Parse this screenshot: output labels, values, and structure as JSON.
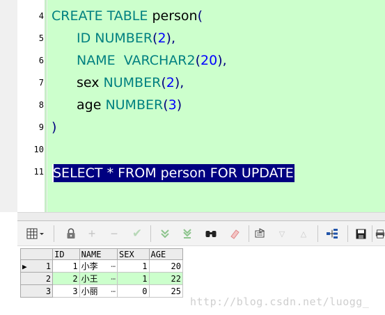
{
  "editor": {
    "line_numbers": [
      "4",
      "5",
      "6",
      "7",
      "8",
      "9",
      "10",
      "11"
    ],
    "code": {
      "l4_kw": "CREATE TABLE ",
      "l4_id": "person",
      "l4_p": "(",
      "l5_kw": "ID NUMBER",
      "l5_p1": "(",
      "l5_n": "2",
      "l5_p2": "),",
      "l6_kw": "NAME  VARCHAR2",
      "l6_p1": "(",
      "l6_n": "20",
      "l6_p2": "),",
      "l7_id": "sex ",
      "l7_kw": "NUMBER",
      "l7_p1": "(",
      "l7_n": "2",
      "l7_p2": "),",
      "l8_id": "age ",
      "l8_kw": "NUMBER",
      "l8_p1": "(",
      "l8_n": "3",
      "l8_p2": ")",
      "l9_p": ")",
      "l11": "SELECT * FROM person FOR UPDATE"
    },
    "colors": {
      "code_bg": "#ccffcc",
      "keyword": "#008080",
      "number": "#0000ff",
      "selection": "#000080"
    }
  },
  "toolbar": {
    "icons": [
      "grid-menu-icon",
      "lock-icon",
      "add-record-icon",
      "delete-record-icon",
      "post-changes-icon",
      "fetch-next-icon",
      "fetch-last-icon",
      "find-icon",
      "clear-icon",
      "query-by-example-icon",
      "next-icon",
      "previous-icon",
      "single-record-icon",
      "save-icon",
      "print-icon"
    ]
  },
  "grid": {
    "columns": [
      "",
      "ID",
      "NAME",
      "SEX",
      "AGE"
    ],
    "rows": [
      {
        "rn": "1",
        "id": "1",
        "name": "小李",
        "sex": "1",
        "age": "20"
      },
      {
        "rn": "2",
        "id": "2",
        "name": "小王",
        "sex": "1",
        "age": "22"
      },
      {
        "rn": "3",
        "id": "3",
        "name": "小丽",
        "sex": "0",
        "age": "25"
      }
    ],
    "ellipsis": "…",
    "current_row_marker": "▶"
  },
  "watermark": "http://blog.csdn.net/luogg_"
}
